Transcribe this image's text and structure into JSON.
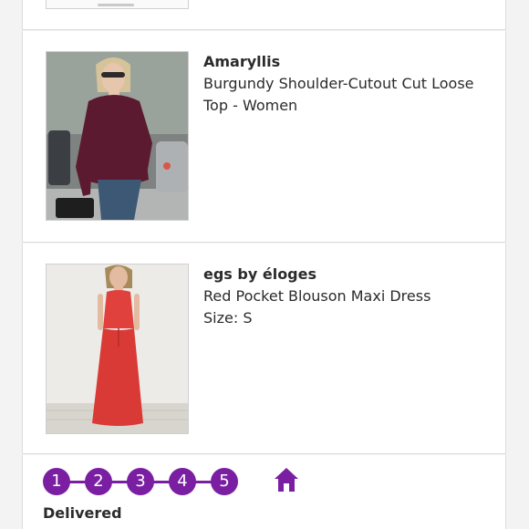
{
  "items": [
    {
      "brand": "Amaryllis",
      "title_line1": "Burgundy Shoulder-Cutout Cut Loose",
      "title_line2": "Top - Women",
      "image": "model-burgundy-top-photo"
    },
    {
      "brand": "egs by éloges",
      "title_line1": "Red Pocket Blouson Maxi Dress",
      "size": "Size: S",
      "image": "model-red-maxi-dress-photo"
    }
  ],
  "tracker": {
    "steps": [
      "1",
      "2",
      "3",
      "4",
      "5"
    ],
    "status": "Delivered",
    "accent": "#7a1fa2",
    "end_icon": "home-icon"
  }
}
